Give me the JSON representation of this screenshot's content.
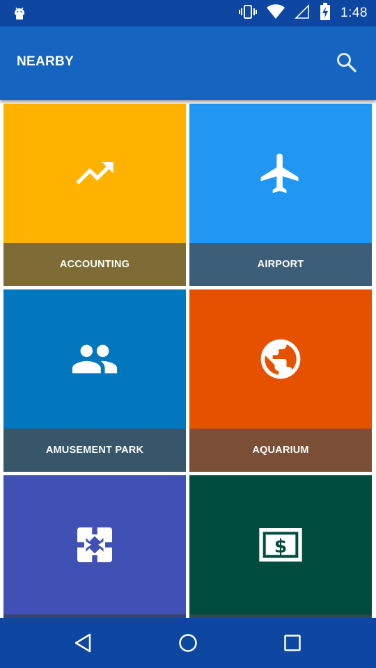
{
  "status_bar": {
    "time": "1:48",
    "icons": [
      "android-debug-icon",
      "vibrate-icon",
      "wifi-icon",
      "signal-icon",
      "battery-charging-icon"
    ]
  },
  "app_bar": {
    "title": "NEARBY",
    "search_icon": "search-icon"
  },
  "tiles": [
    {
      "label": "ACCOUNTING",
      "icon": "trending-up-icon",
      "color": "#ffb300",
      "label_color": "#7e6b36"
    },
    {
      "label": "AIRPORT",
      "icon": "airplane-icon",
      "color": "#2196f3",
      "label_color": "#3d5e78"
    },
    {
      "label": "AMUSEMENT PARK",
      "icon": "group-icon",
      "color": "#0277bd",
      "label_color": "#37566a"
    },
    {
      "label": "AQUARIUM",
      "icon": "globe-icon",
      "color": "#e65100",
      "label_color": "#7a4f35"
    },
    {
      "label": "",
      "icon": "photo-frame-icon",
      "color": "#3f51b5",
      "label_color": "#3a4368"
    },
    {
      "label": "",
      "icon": "cash-icon",
      "color": "#004d40",
      "label_color": "#2a4b47"
    }
  ],
  "nav_bar": {
    "back": "back-icon",
    "home": "home-icon",
    "recents": "recents-icon"
  }
}
